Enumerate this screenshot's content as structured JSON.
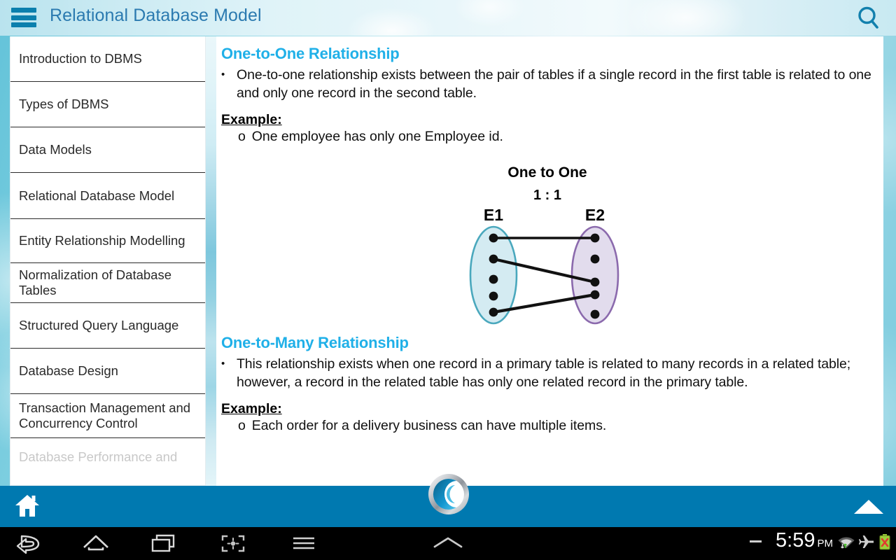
{
  "header": {
    "title": "Relational Database Model",
    "menu_icon": "hamburger-icon",
    "search_icon": "search-icon"
  },
  "sidebar": {
    "items": [
      {
        "label": "Introduction to DBMS",
        "state": "normal"
      },
      {
        "label": "Types of DBMS",
        "state": "normal"
      },
      {
        "label": "Data Models",
        "state": "normal"
      },
      {
        "label": "Relational Database Model",
        "state": "selected"
      },
      {
        "label": "Entity Relationship Modelling",
        "state": "normal"
      },
      {
        "label": "Normalization of Database Tables",
        "state": "normal"
      },
      {
        "label": "Structured Query Language",
        "state": "normal"
      },
      {
        "label": "Database Design",
        "state": "normal"
      },
      {
        "label": "Transaction Management and Concurrency Control",
        "state": "normal"
      },
      {
        "label": "Database Performance and",
        "state": "faded"
      }
    ]
  },
  "content": {
    "sections": [
      {
        "title": "One-to-One Relationship",
        "bullet": "One-to-one relationship exists between the pair of tables if a single record in the first table is related to one and only one record in the second table.",
        "example_label": "Example:",
        "example_marker": "o",
        "example_text": "One employee has only one Employee id."
      },
      {
        "title": "One-to-Many Relationship",
        "bullet": "This relationship exists when one record in a primary table is related to many records in a related table; however, a record in the related table has only one related record in the primary table.",
        "example_label": "Example:",
        "example_marker": "o",
        "example_text": "Each order for a delivery business can have multiple items."
      }
    ]
  },
  "diagram": {
    "title": "One to One",
    "ratio": "1 : 1",
    "left_label": "E1",
    "right_label": "E2",
    "left_ellipse_fill": "#d4ebf2",
    "left_ellipse_stroke": "#4aa8bd",
    "right_ellipse_fill": "#e2dced",
    "right_ellipse_stroke": "#8b6aad",
    "left_dot_count": 5,
    "right_dot_count": 5,
    "connections": [
      {
        "from": 0,
        "to": 0
      },
      {
        "from": 1,
        "to": 2
      },
      {
        "from": 4,
        "to": 3
      }
    ]
  },
  "bottombar": {
    "home_icon": "home-icon",
    "logo_icon": "brand-logo-icon",
    "up_arrow_icon": "collapse-up-arrow-icon",
    "accent_color": "#0079b0"
  },
  "navbar": {
    "back_icon": "back-arrow-icon",
    "home_icon": "home-outline-icon",
    "recents_icon": "recent-apps-icon",
    "screenshot_icon": "screenshot-icon",
    "menu_icon": "menu-icon",
    "center_icon": "chevron-up-icon",
    "minus_icon": "minus-icon",
    "time": "5:59",
    "meridiem": "PM",
    "wifi_icon": "wifi-signal-icon",
    "airplane_icon": "airplane-mode-icon",
    "battery_icon": "battery-error-icon"
  }
}
